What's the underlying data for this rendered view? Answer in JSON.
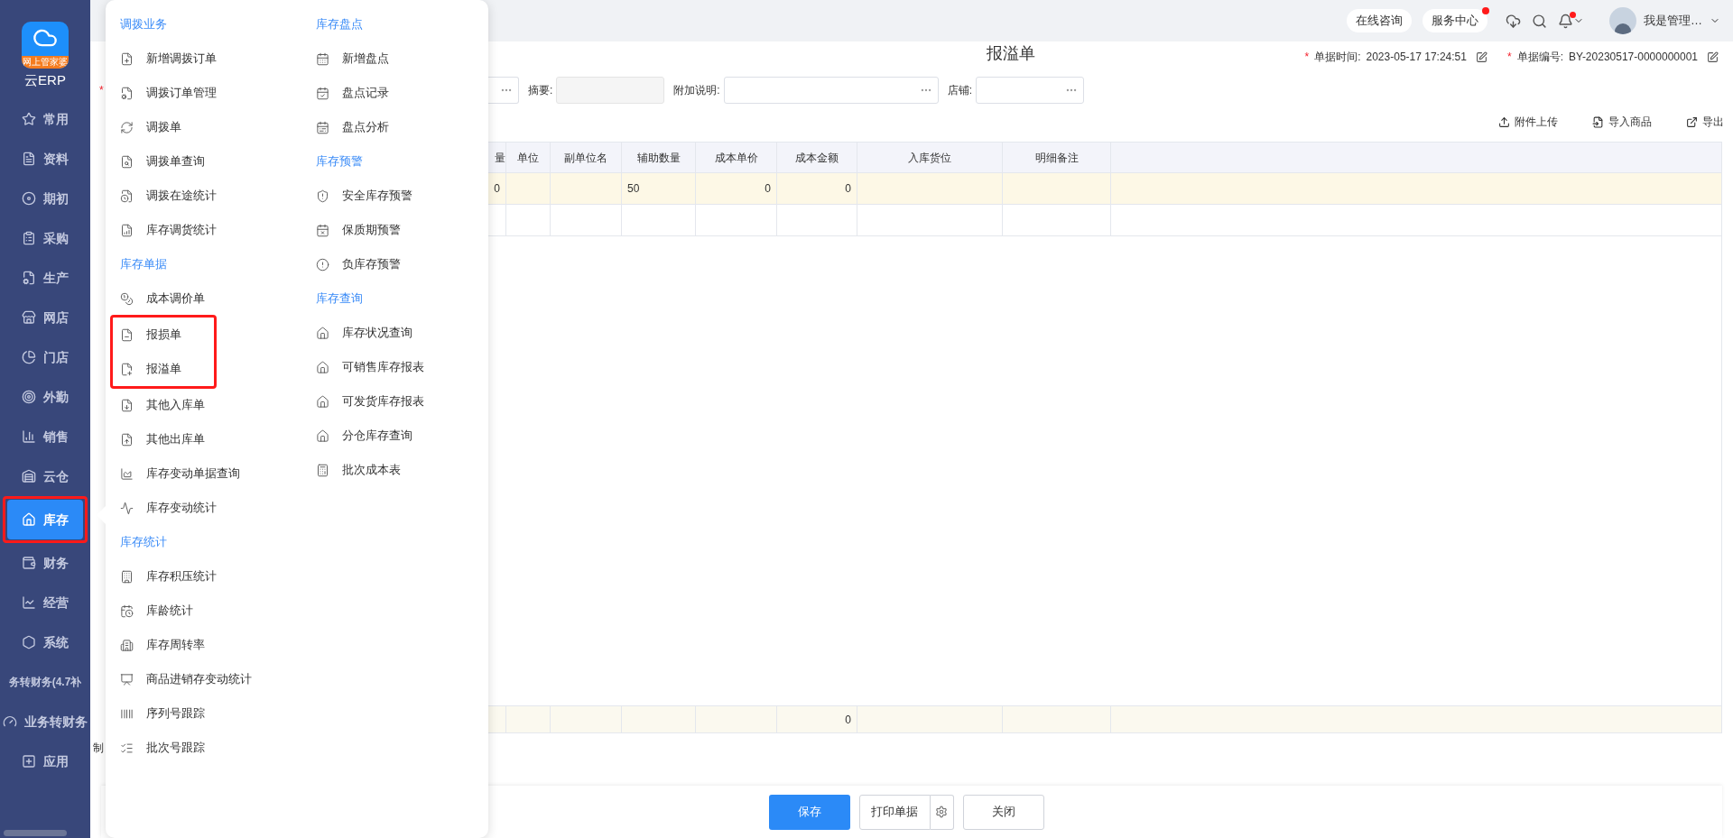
{
  "sidebar": {
    "logo_text": "网上管家婆",
    "app_name": "云ERP",
    "items": [
      {
        "label": "常用",
        "selected": false,
        "highlighted": false
      },
      {
        "label": "资料",
        "selected": false,
        "highlighted": false
      },
      {
        "label": "期初",
        "selected": false,
        "highlighted": false
      },
      {
        "label": "采购",
        "selected": false,
        "highlighted": false
      },
      {
        "label": "生产",
        "selected": false,
        "highlighted": false
      },
      {
        "label": "网店",
        "selected": false,
        "highlighted": false
      },
      {
        "label": "门店",
        "selected": false,
        "highlighted": false
      },
      {
        "label": "外勤",
        "selected": false,
        "highlighted": false
      },
      {
        "label": "销售",
        "selected": false,
        "highlighted": false
      },
      {
        "label": "云仓",
        "selected": false,
        "highlighted": false
      },
      {
        "label": "库存",
        "selected": true,
        "highlighted": true
      },
      {
        "label": "财务",
        "selected": false,
        "highlighted": false
      },
      {
        "label": "经营",
        "selected": false,
        "highlighted": false
      },
      {
        "label": "系统",
        "selected": false,
        "highlighted": false
      },
      {
        "label": "务转财务(4.7补",
        "selected": false,
        "highlighted": false
      },
      {
        "label": "业务转财务",
        "selected": false,
        "highlighted": false
      },
      {
        "label": "应用",
        "selected": false,
        "highlighted": false
      }
    ]
  },
  "menu": {
    "columns": [
      {
        "sections": [
          {
            "heading": "调拨业务",
            "items": [
              {
                "label": "新增调拨订单",
                "highlighted": false
              },
              {
                "label": "调拨订单管理",
                "highlighted": false
              },
              {
                "label": "调拨单",
                "highlighted": false
              },
              {
                "label": "调拨单查询",
                "highlighted": false
              },
              {
                "label": "调拨在途统计",
                "highlighted": false
              },
              {
                "label": "库存调货统计",
                "highlighted": false
              }
            ]
          },
          {
            "heading": "库存单据",
            "items": [
              {
                "label": "成本调价单",
                "highlighted": false
              },
              {
                "label": "报损单",
                "highlighted": true
              },
              {
                "label": "报溢单",
                "highlighted": true
              },
              {
                "label": "其他入库单",
                "highlighted": false
              },
              {
                "label": "其他出库单",
                "highlighted": false
              },
              {
                "label": "库存变动单据查询",
                "highlighted": false
              },
              {
                "label": "库存变动统计",
                "highlighted": false
              }
            ]
          },
          {
            "heading": "库存统计",
            "items": [
              {
                "label": "库存积压统计",
                "highlighted": false
              },
              {
                "label": "库龄统计",
                "highlighted": false
              },
              {
                "label": "库存周转率",
                "highlighted": false
              },
              {
                "label": "商品进销存变动统计",
                "highlighted": false
              },
              {
                "label": "序列号跟踪",
                "highlighted": false
              },
              {
                "label": "批次号跟踪",
                "highlighted": false
              }
            ]
          }
        ]
      },
      {
        "sections": [
          {
            "heading": "库存盘点",
            "items": [
              {
                "label": "新增盘点",
                "highlighted": false
              },
              {
                "label": "盘点记录",
                "highlighted": false
              },
              {
                "label": "盘点分析",
                "highlighted": false
              }
            ]
          },
          {
            "heading": "库存预警",
            "items": [
              {
                "label": "安全库存预警",
                "highlighted": false
              },
              {
                "label": "保质期预警",
                "highlighted": false
              },
              {
                "label": "负库存预警",
                "highlighted": false
              }
            ]
          },
          {
            "heading": "库存查询",
            "items": [
              {
                "label": "库存状况查询",
                "highlighted": false
              },
              {
                "label": "可销售库存报表",
                "highlighted": false
              },
              {
                "label": "可发货库存报表",
                "highlighted": false
              },
              {
                "label": "分仓库存查询",
                "highlighted": false
              },
              {
                "label": "批次成本表",
                "highlighted": false
              }
            ]
          }
        ]
      }
    ]
  },
  "top_bar": {
    "buttons": [
      {
        "label": "在线咨询",
        "badge": false
      },
      {
        "label": "服务中心",
        "badge": true
      }
    ],
    "notification_badge": true,
    "user_name": "我是管理…"
  },
  "document": {
    "title": "报溢单",
    "meta": [
      {
        "label": "单据时间:",
        "value": "2023-05-17 17:24:51",
        "required": true
      },
      {
        "label": "单据编号:",
        "value": "BY-20230517-0000000001",
        "required": true
      }
    ],
    "required_mark": "*",
    "fields": [
      {
        "kind": "picker"
      },
      {
        "label": "摘要:",
        "kind": "readonly"
      },
      {
        "label": "附加说明:",
        "kind": "picker"
      },
      {
        "label": "店铺:",
        "kind": "picker"
      }
    ],
    "toolbar": [
      "附件上传",
      "导入商品",
      "导出"
    ],
    "footer_note": "制"
  },
  "table": {
    "columns": [
      "量",
      "单位",
      "副单位名",
      "辅助数量",
      "成本单价",
      "成本金额",
      "入库货位",
      "明细备注"
    ],
    "rows": [
      {
        "selected": true,
        "cells": [
          "0",
          null,
          null,
          "50",
          "0",
          "0",
          null,
          null
        ]
      },
      {
        "selected": false,
        "cells": [
          null,
          null,
          null,
          null,
          null,
          null,
          null,
          null
        ]
      }
    ],
    "totals": {
      "cost_amount": "0"
    }
  },
  "buttons": [
    {
      "label": "保存",
      "kind": "primary"
    },
    {
      "label": "打印单据",
      "kind": "split"
    },
    {
      "label": "关闭",
      "kind": "default"
    }
  ]
}
